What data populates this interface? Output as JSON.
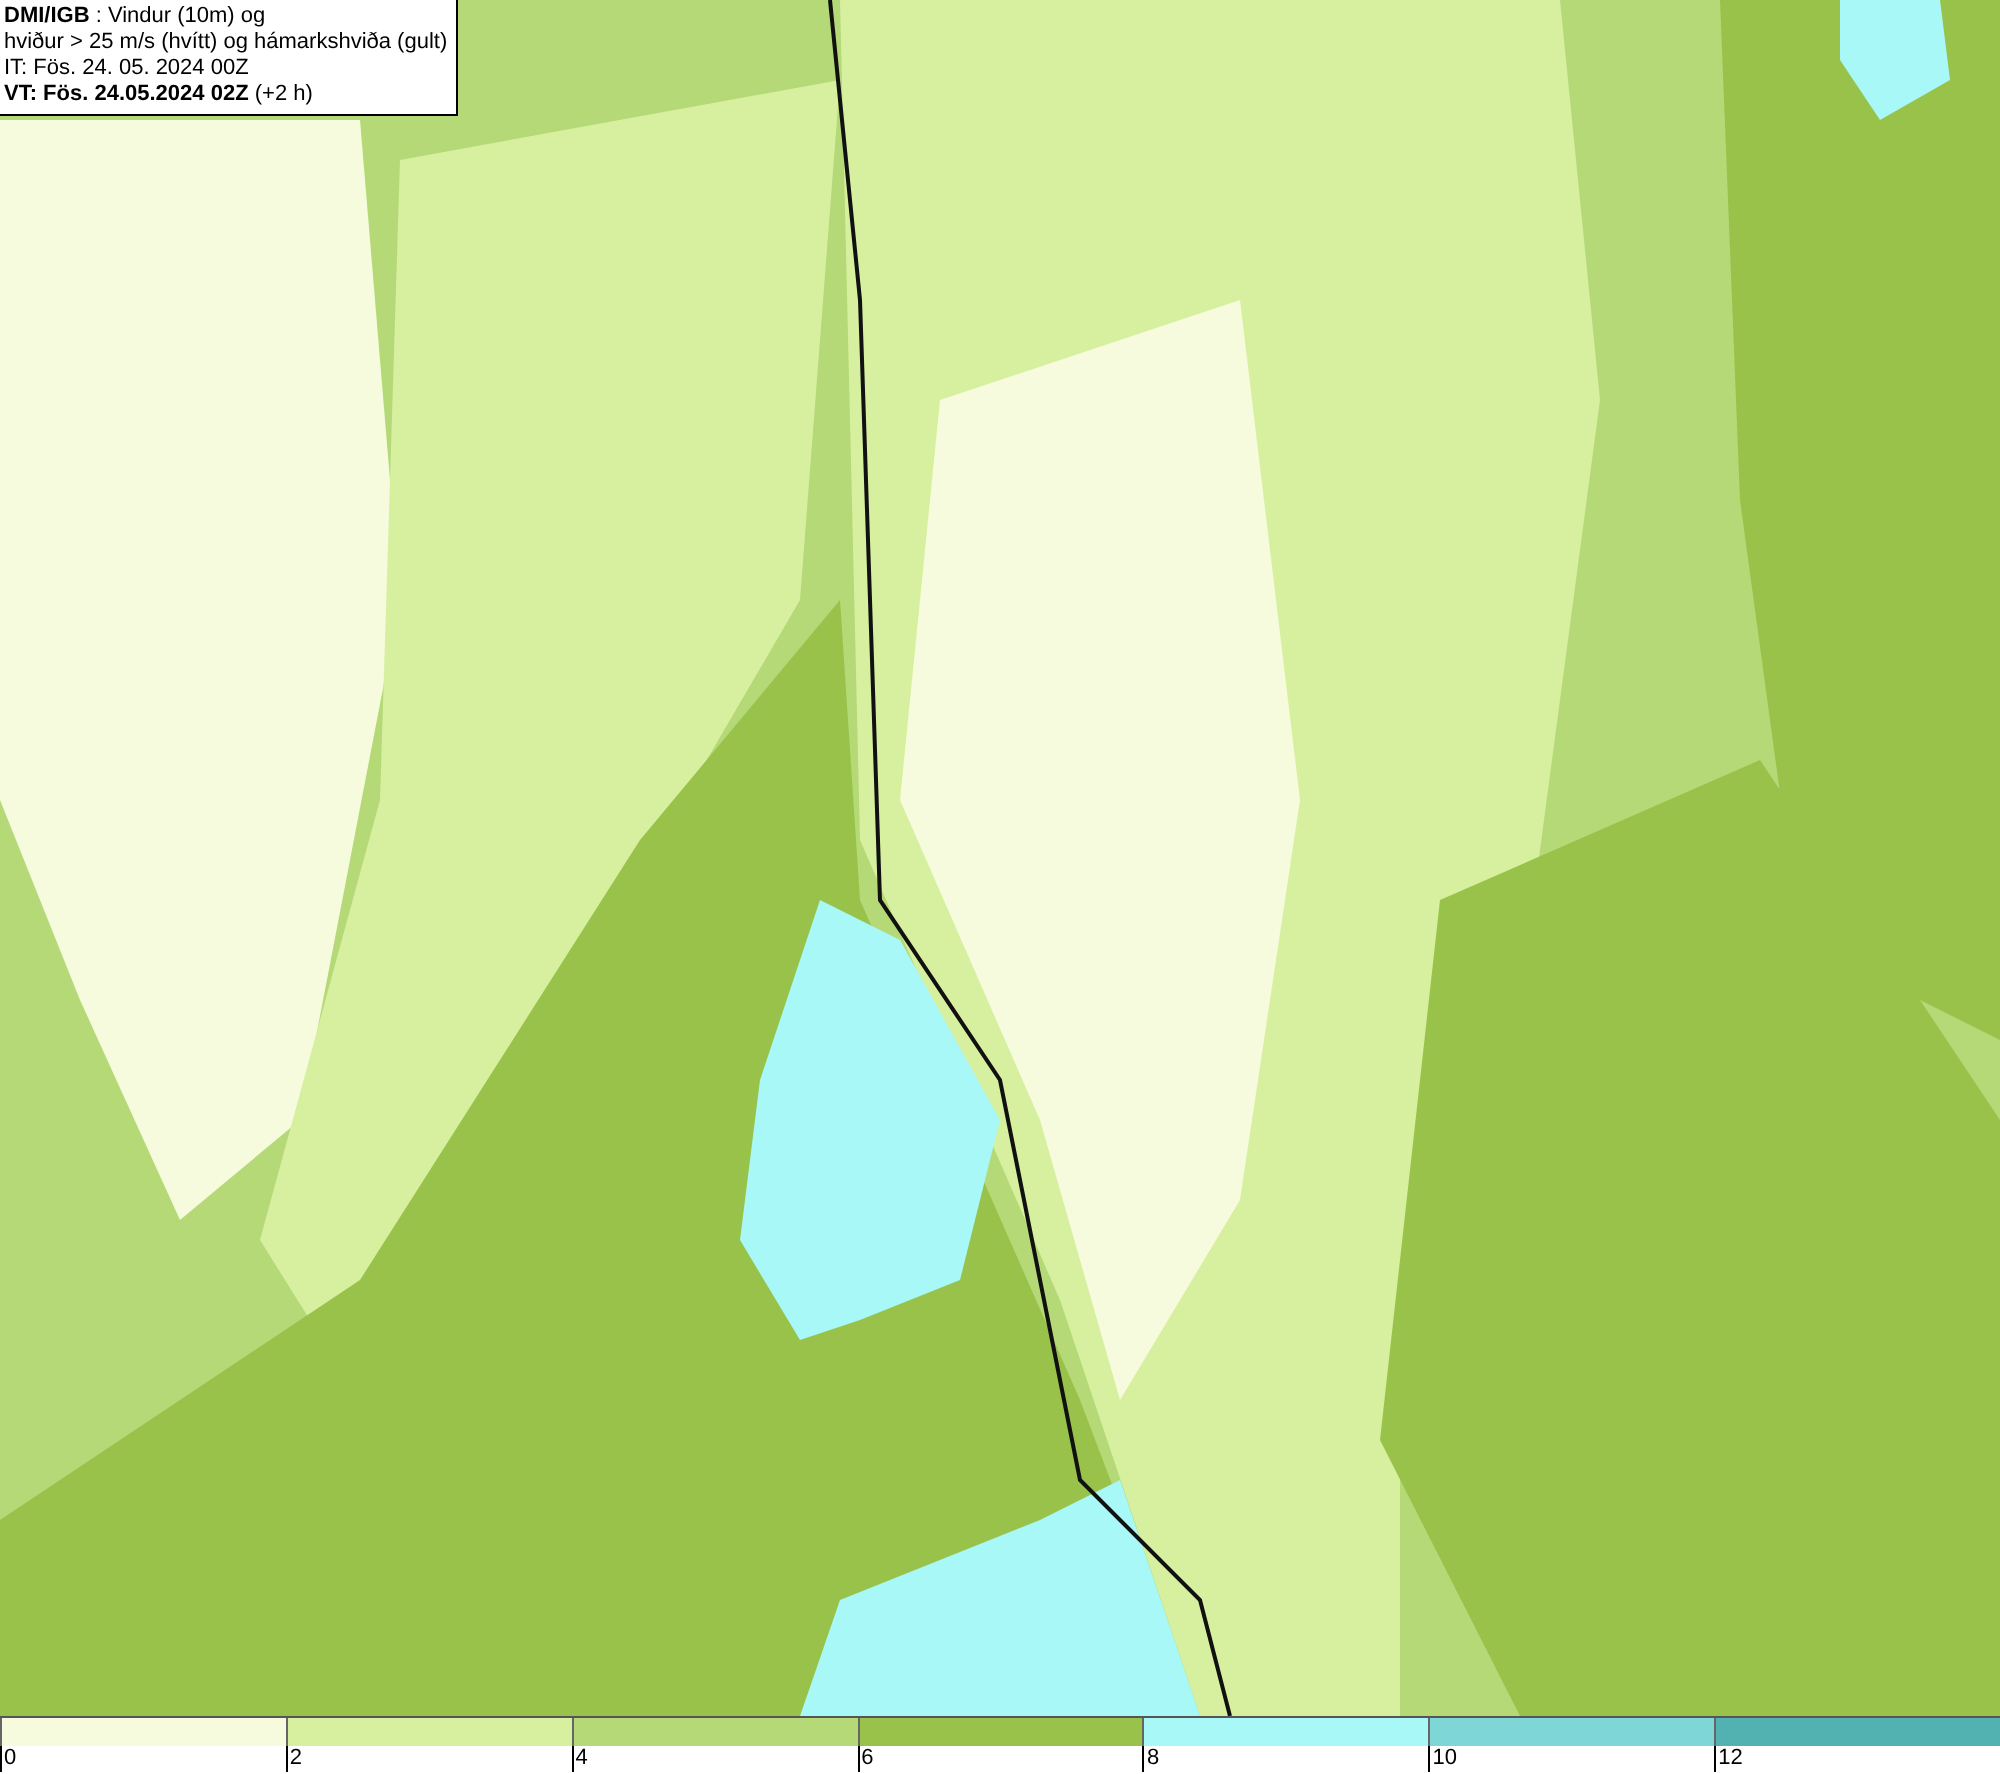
{
  "legend": {
    "lines": [
      "**DMI/IGB** : Vindur (10m) og",
      "hviður > 25 m/s (hvítt) og hámarkshviða (gult)",
      "IT: Fös. 24. 05. 2024 00Z",
      "**VT: Fös. 24.05.2024 02Z** (+2 h)"
    ]
  },
  "colorbar": {
    "segments": [
      {
        "color": "#f5fbdc"
      },
      {
        "color": "#d7f0a0"
      },
      {
        "color": "#b5d977"
      },
      {
        "color": "#98c24a"
      },
      {
        "color": "#a8f8f8"
      },
      {
        "color": "#7ed6d6"
      },
      {
        "color": "#52b2b2"
      }
    ],
    "ticks": [
      "0",
      "2",
      "4",
      "6",
      "8",
      "10",
      "12"
    ]
  }
}
